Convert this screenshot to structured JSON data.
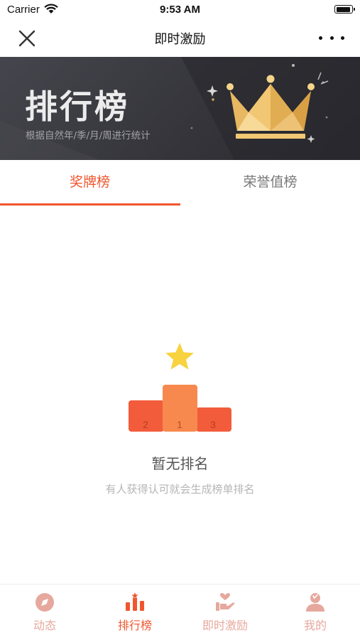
{
  "status_bar": {
    "carrier": "Carrier",
    "time": "9:53 AM"
  },
  "nav": {
    "title": "即时激励"
  },
  "banner": {
    "title": "排行榜",
    "subtitle": "根据自然年/季/月/周进行统计"
  },
  "tabs": [
    {
      "label": "奖牌榜",
      "selected": true
    },
    {
      "label": "荣誉值榜",
      "selected": false
    }
  ],
  "podium": {
    "left_number": "2",
    "center_number": "1",
    "right_number": "3"
  },
  "empty_state": {
    "title": "暂无排名",
    "description": "有人获得认可就会生成榜单排名"
  },
  "tab_bar": [
    {
      "label": "动态",
      "icon": "compass-icon",
      "active": false
    },
    {
      "label": "排行榜",
      "icon": "ranking-bars-icon",
      "active": true
    },
    {
      "label": "即时激励",
      "icon": "hand-heart-icon",
      "active": false
    },
    {
      "label": "我的",
      "icon": "person-icon",
      "active": false
    }
  ],
  "colors": {
    "accent": "#f0562e",
    "inactive_tab_icon": "#e6a89e",
    "banner_bg": "#3a3a40",
    "crown_gold": "#f1c774"
  }
}
